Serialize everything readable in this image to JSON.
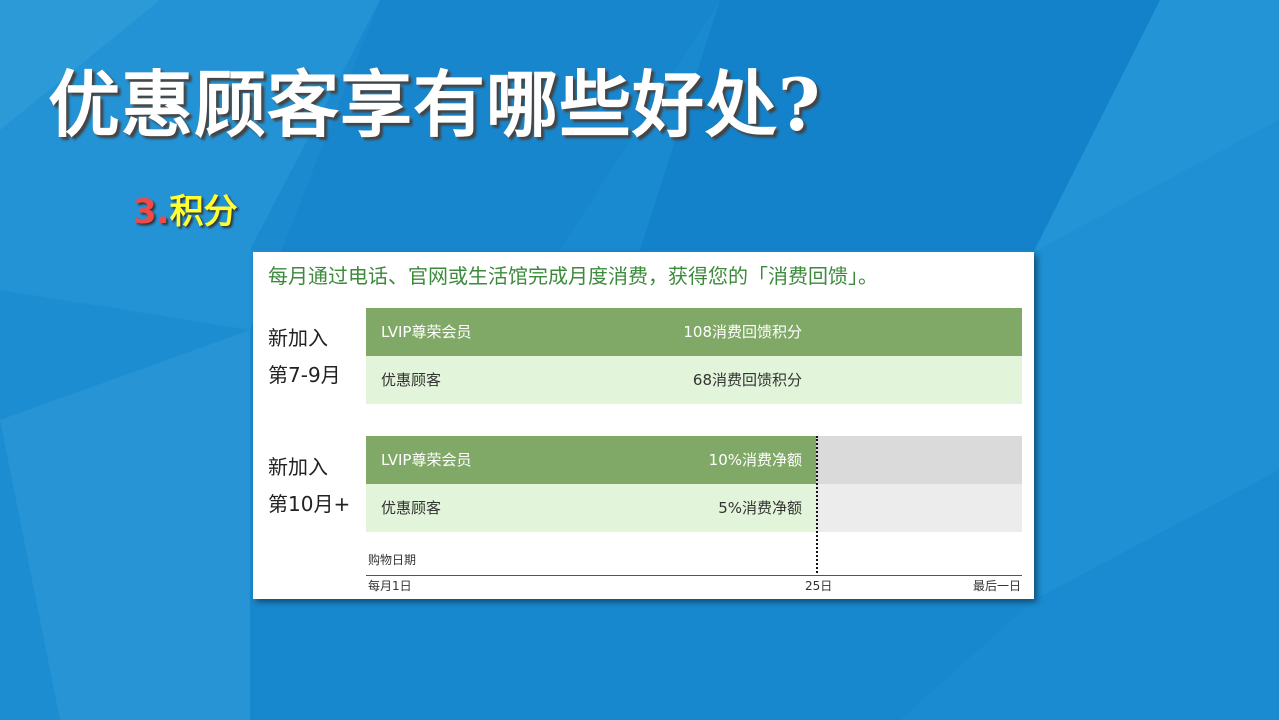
{
  "slide": {
    "title": "优惠顾客享有哪些好处?",
    "section_number": "3.",
    "section_title": "积分"
  },
  "panel": {
    "intro": "每月通过电话、官网或生活馆完成月度消费，获得您的「消费回馈」。",
    "groups": [
      {
        "label_line1": "新加入",
        "label_line2": "第7-9月",
        "rows": [
          {
            "name": "LVIP尊荣会员",
            "value": "108消费回馈积分"
          },
          {
            "name": "优惠顾客",
            "value": "68消费回馈积分"
          }
        ]
      },
      {
        "label_line1": "新加入",
        "label_line2": "第10月+",
        "rows": [
          {
            "name": "LVIP尊荣会员",
            "value": "10%消费净额"
          },
          {
            "name": "优惠顾客",
            "value": "5%消费净额"
          }
        ]
      }
    ],
    "axis": {
      "title": "购物日期",
      "tick_start": "每月1日",
      "tick_cutoff": "25日",
      "tick_end": "最后一日"
    }
  },
  "colors": {
    "background": "#1a8ad0",
    "title_text": "#ffffff",
    "section_number": "#ee4a4a",
    "section_title": "#ffff33",
    "intro_text": "#3c8a3c",
    "bar_dark": "#80a968",
    "bar_light": "#e2f4da",
    "bar_gray": "#dadada"
  }
}
